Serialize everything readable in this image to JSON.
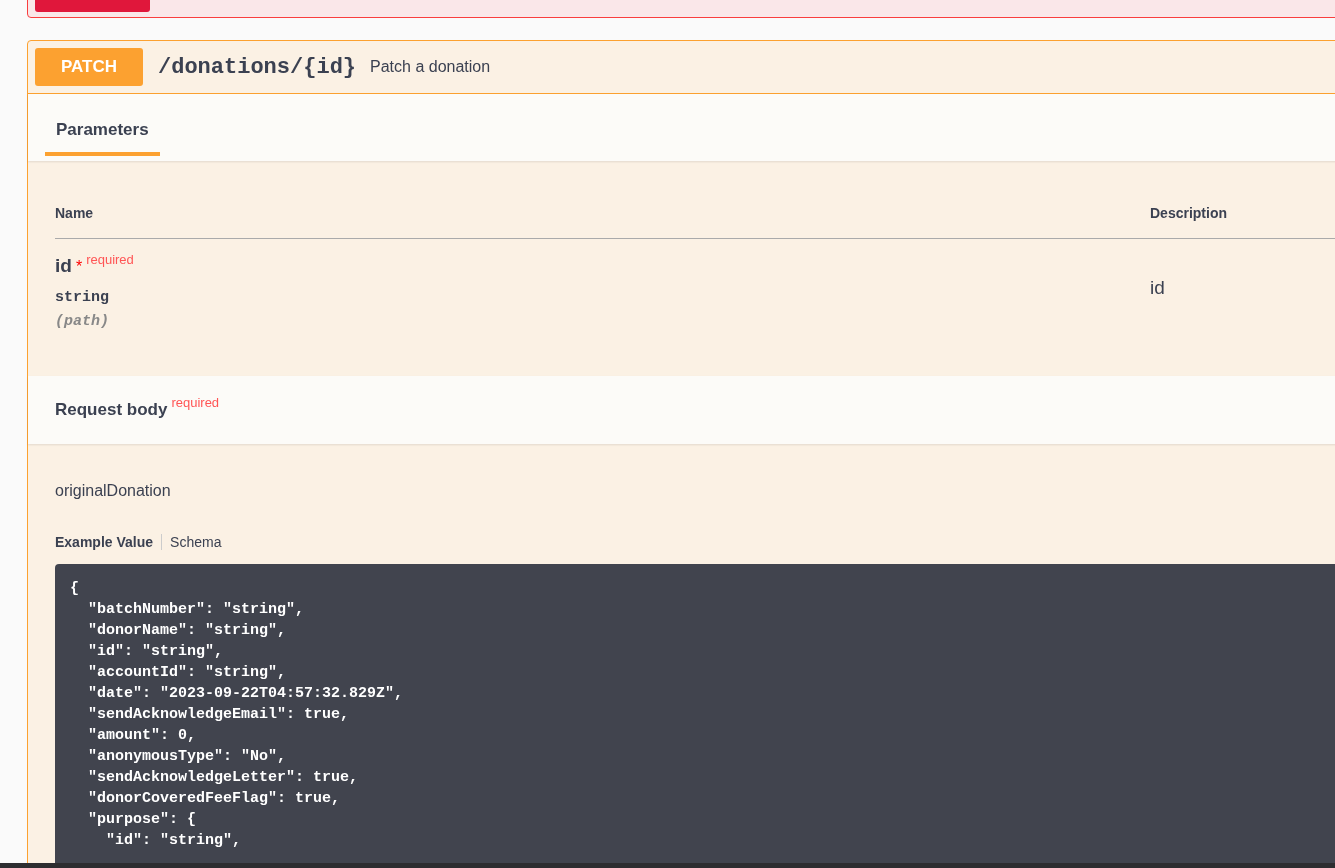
{
  "operation": {
    "method": "PATCH",
    "path": "/donations/{id}",
    "summary": "Patch a donation"
  },
  "tabs": [
    {
      "label": "Parameters",
      "selected": true
    }
  ],
  "parameters": {
    "columns": [
      "Name",
      "Description"
    ],
    "rows": [
      {
        "name": "id",
        "required_mark": "*",
        "required_label": "required",
        "type": "string",
        "location": "(path)",
        "description": "id"
      }
    ]
  },
  "request_body": {
    "title": "Request body",
    "required_label": "required",
    "name": "originalDonation",
    "view_tabs": [
      {
        "label": "Example Value",
        "selected": true
      },
      {
        "label": "Schema",
        "selected": false
      }
    ],
    "code_lines": [
      "{",
      "  \"batchNumber\": \"string\",",
      "  \"donorName\": \"string\",",
      "  \"id\": \"string\",",
      "  \"accountId\": \"string\",",
      "  \"date\": \"2023-09-22T04:57:32.829Z\",",
      "  \"sendAcknowledgeEmail\": true,",
      "  \"amount\": 0,",
      "  \"anonymousType\": \"No\",",
      "  \"sendAcknowledgeLetter\": true,",
      "  \"donorCoveredFeeFlag\": true,",
      "  \"purpose\": {",
      "    \"id\": \"string\","
    ]
  }
}
